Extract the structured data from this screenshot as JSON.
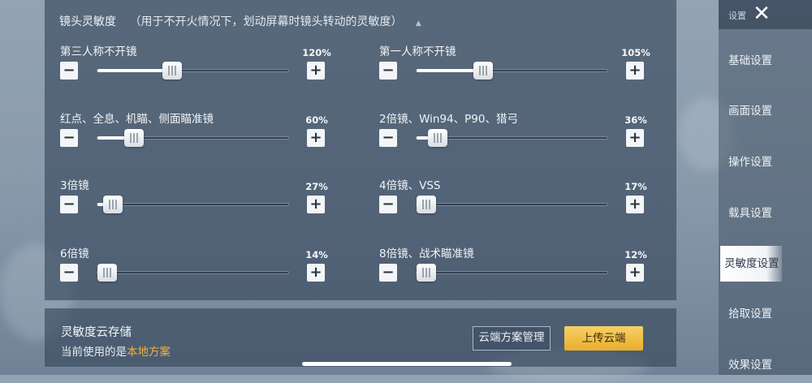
{
  "header": {
    "title": "镜头灵敏度",
    "hint": "（用于不开火情况下，划动屏幕时镜头转动的灵敏度）",
    "caret": "▲"
  },
  "sliders": [
    {
      "label": "第三人称不开镜",
      "value_text": "120%",
      "position": 0.39
    },
    {
      "label": "第一人称不开镜",
      "value_text": "105%",
      "position": 0.35
    },
    {
      "label": "红点、全息、机瞄、侧面瞄准镜",
      "value_text": "60%",
      "position": 0.19
    },
    {
      "label": "2倍镜、Win94、P90、猎弓",
      "value_text": "36%",
      "position": 0.11
    },
    {
      "label": "3倍镜",
      "value_text": "27%",
      "position": 0.08
    },
    {
      "label": "4倍镜、VSS",
      "value_text": "17%",
      "position": 0.05
    },
    {
      "label": "6倍镜",
      "value_text": "14%",
      "position": 0.04
    },
    {
      "label": "8倍镜、战术瞄准镜",
      "value_text": "12%",
      "position": 0.03
    }
  ],
  "buttons": {
    "minus": "−",
    "plus": "+"
  },
  "cloud_save": {
    "title": "灵敏度云存储",
    "current_prefix": "当前使用的是",
    "current_scheme": "本地方案",
    "manage_label": "云端方案管理",
    "upload_label": "上传云端"
  },
  "sidebar": {
    "title": "设置",
    "close": "✕",
    "items": [
      {
        "label": "基础设置"
      },
      {
        "label": "画面设置"
      },
      {
        "label": "操作设置"
      },
      {
        "label": "载具设置"
      },
      {
        "label": "灵敏度设置"
      },
      {
        "label": "拾取设置"
      },
      {
        "label": "效果设置"
      }
    ],
    "active_index": 4
  }
}
